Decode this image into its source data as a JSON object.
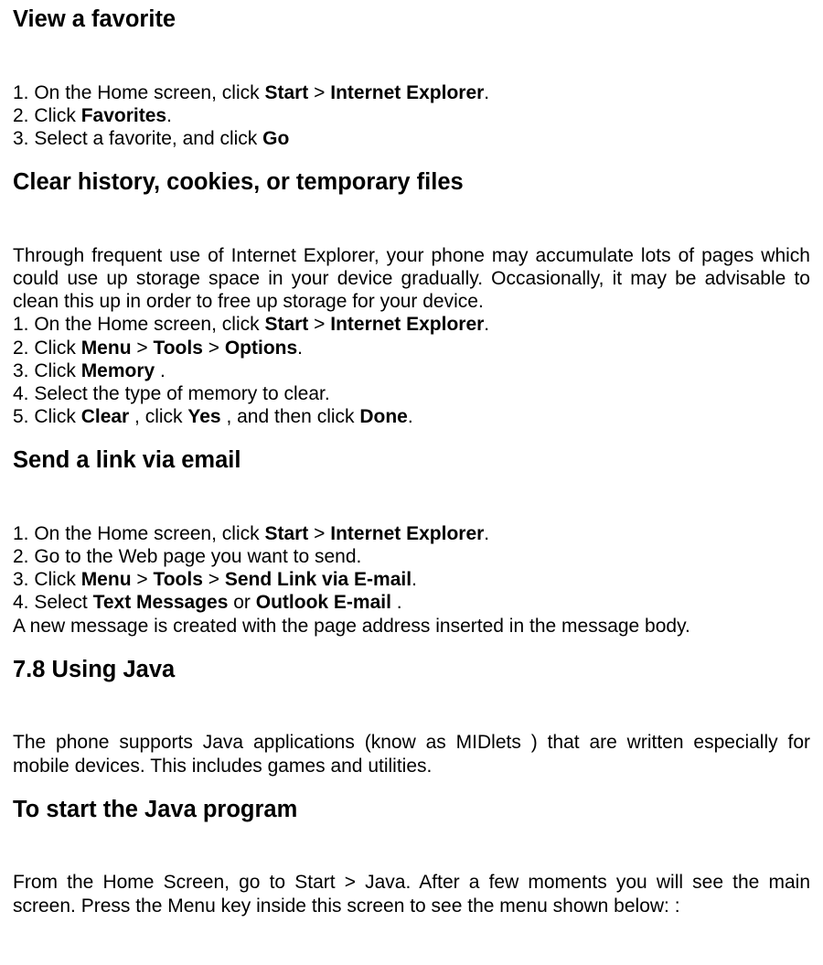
{
  "viewFavorite": {
    "heading": "View a favorite",
    "step1_a": "1. On the Home screen, click ",
    "step1_b1": "Start",
    "step1_sep": " > ",
    "step1_b2": "Internet Explorer",
    "step1_end": ".",
    "step2_a": "2. Click ",
    "step2_b": "Favorites",
    "step2_end": ".",
    "step3_a": "3. Select a favorite, and click ",
    "step3_b": "Go"
  },
  "clearHistory": {
    "heading": "Clear history, cookies, or temporary files",
    "intro": "Through frequent use of Internet Explorer, your phone may accumulate lots of pages which could use up storage space in your device gradually. Occasionally, it may be advisable to clean this up in order to free up storage for your device.",
    "step1_a": "1. On the Home screen, click ",
    "step1_b1": "Start",
    "step1_sep": " > ",
    "step1_b2": "Internet Explorer",
    "step1_end": ".",
    "step2_a": "2. Click ",
    "step2_b1": "Menu",
    "step2_sep1": " > ",
    "step2_b2": "Tools",
    "step2_sep2": " > ",
    "step2_b3": "Options",
    "step2_end": ".",
    "step3_a": "3. Click ",
    "step3_b": "Memory",
    "step3_end": " .",
    "step4": "4. Select the type of memory to clear.",
    "step5_a": "5. Click ",
    "step5_b1": "Clear",
    "step5_mid1": " , click ",
    "step5_b2": "Yes",
    "step5_mid2": " , and then click ",
    "step5_b3": "Done",
    "step5_end": "."
  },
  "sendLink": {
    "heading": "Send a link via email",
    "step1_a": "1. On the Home screen, click ",
    "step1_b1": "Start",
    "step1_sep": " > ",
    "step1_b2": "Internet Explorer",
    "step1_end": ".",
    "step2": "2. Go to the Web page you want to send.",
    "step3_a": "3. Click ",
    "step3_b1": "Menu",
    "step3_sep1": " > ",
    "step3_b2": "Tools",
    "step3_sep2": " > ",
    "step3_b3": "Send Link via E-mail",
    "step3_end": ".",
    "step4_a": "4. Select ",
    "step4_b1": "Text Messages",
    "step4_mid": " or ",
    "step4_b2": "Outlook E-mail",
    "step4_end": " .",
    "note": "A new message is created with the page address inserted in the message body."
  },
  "usingJava": {
    "heading": "7.8 Using Java",
    "intro": "The phone supports Java applications (know as MIDlets ) that are written especially for mobile devices. This includes games and utilities."
  },
  "startJava": {
    "heading": "To start the Java program",
    "intro": "From the Home Screen, go to Start > Java. After a few moments you will see the main screen. Press the Menu key inside this screen to see the menu shown below: :"
  }
}
